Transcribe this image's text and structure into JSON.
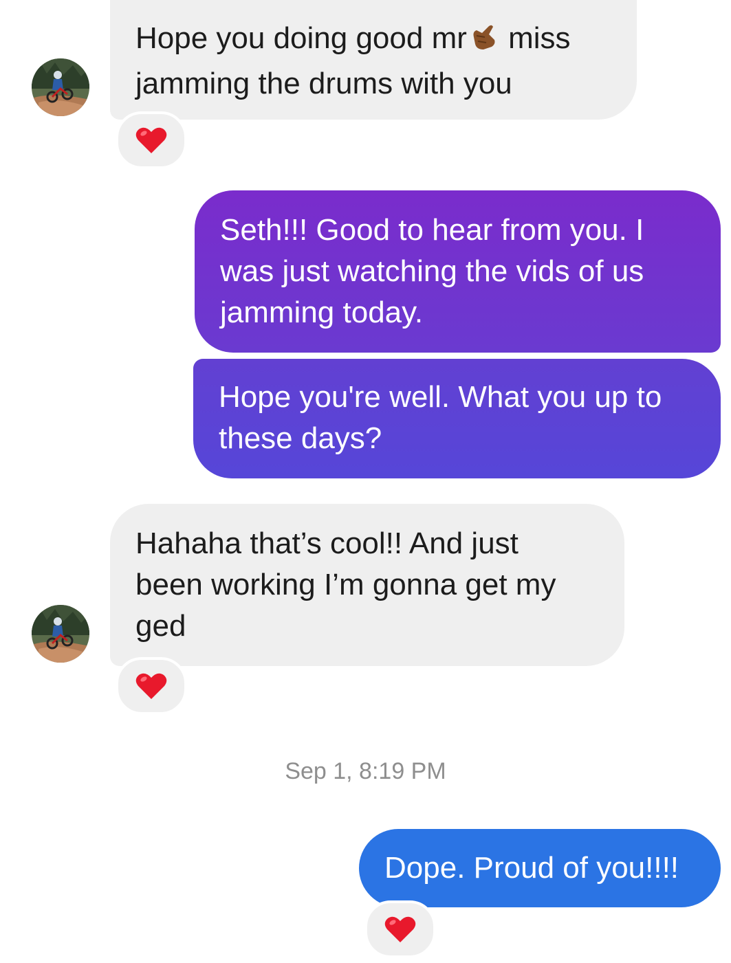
{
  "messages": [
    {
      "sender": "incoming",
      "text_before_emoji": "Hope you doing good mr",
      "emoji": "call-me-hand-icon",
      "text_after_emoji": " miss\njamming the drums with you",
      "reaction": "heart-icon"
    },
    {
      "sender": "outgoing",
      "text": "Seth!!! Good to hear from you.  I\nwas just watching the vids of us\njamming today."
    },
    {
      "sender": "outgoing",
      "text": "Hope you're well. What you up to\nthese days?"
    },
    {
      "sender": "incoming",
      "text": "Hahaha that’s cool!! And just\nbeen working I’m gonna get my\nged",
      "reaction": "heart-icon"
    },
    {
      "sender": "outgoing",
      "text": "Dope. Proud of you!!!!",
      "reaction": "heart-icon"
    }
  ],
  "timestamp": "Sep 1, 8:19 PM",
  "colors": {
    "incoming_bubble": "#efefef",
    "outgoing_purple": "#7a2ccc",
    "outgoing_violet": "#5646d8",
    "outgoing_blue": "#2b74e4",
    "heart": "#e8192c",
    "timestamp_text": "#8e8e8e"
  }
}
